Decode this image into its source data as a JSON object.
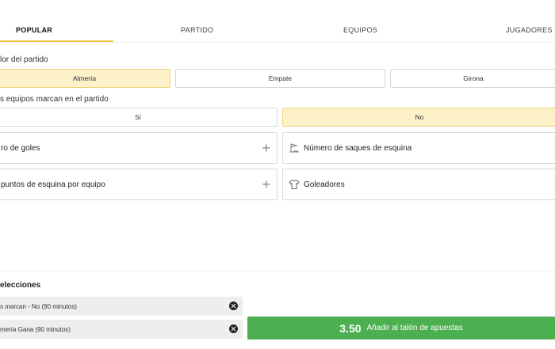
{
  "tabs": [
    {
      "label": "POPULAR",
      "active": true
    },
    {
      "label": "PARTIDO",
      "active": false
    },
    {
      "label": "EQUIPOS",
      "active": false
    },
    {
      "label": "JUGADORES",
      "active": false
    }
  ],
  "markets": {
    "ganador": {
      "title": "lor del partido",
      "options": [
        {
          "label": "Almería",
          "selected": true
        },
        {
          "label": "Empate",
          "selected": false
        },
        {
          "label": "Girona",
          "selected": false
        }
      ]
    },
    "ambos_marcan": {
      "title": "s equipos marcan en el partido",
      "options": [
        {
          "label": "Sí",
          "selected": false
        },
        {
          "label": "No",
          "selected": true
        }
      ]
    },
    "collapsed": [
      {
        "label": "ro de goles",
        "icon": "plus-icon"
      },
      {
        "label": "Número de saques de esquina",
        "icon": "corner-flag-icon"
      },
      {
        "label": "puntos de esquina por equipo",
        "icon": "plus-icon"
      },
      {
        "label": "Goleadores",
        "icon": "shirt-icon"
      }
    ]
  },
  "betslip": {
    "title": "elecciones",
    "selections": [
      {
        "label": "s marcan - No (90 minutos)"
      },
      {
        "label": "mería Gana (90 minutos)"
      }
    ],
    "odds": "3.50",
    "add_label": "Añadir al talón de apuestas"
  },
  "colors": {
    "accent": "#f0c94a",
    "selected_bg": "#fdf1c9",
    "add_button": "#4caf50"
  }
}
